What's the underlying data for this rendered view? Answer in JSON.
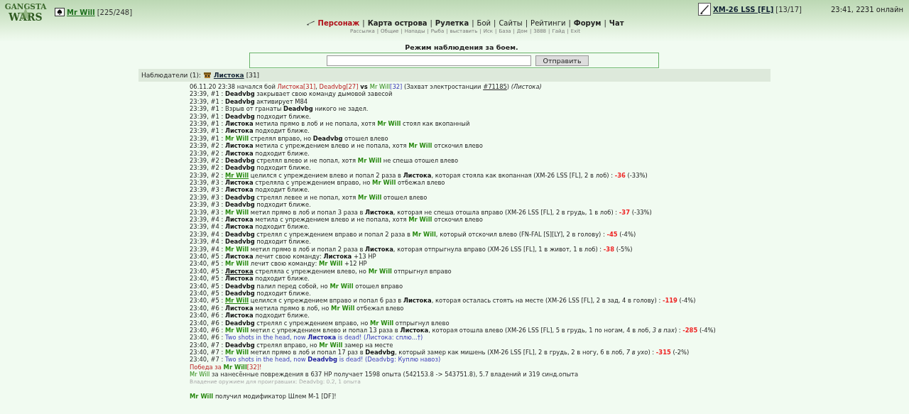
{
  "header": {
    "logo_top": "GANGSTA",
    "logo_bottom": "WARS",
    "player": {
      "name": "Mr Will",
      "hp": "[225/248]"
    },
    "weapon": {
      "name": "XM-26 LSS [FL]",
      "ammo": "[13/17]"
    },
    "status": "23:41, 2231 онлайн"
  },
  "separator": "|",
  "nav": [
    {
      "label": "Персонаж",
      "kind": "current"
    },
    {
      "label": "Карта острова",
      "kind": "bold"
    },
    {
      "label": "Рулетка",
      "kind": "bold"
    },
    {
      "label": "Бой",
      "kind": "plain"
    },
    {
      "label": "Сайты",
      "kind": "plain"
    },
    {
      "label": "Рейтинги",
      "kind": "plain"
    },
    {
      "label": "Форум",
      "kind": "bold"
    },
    {
      "label": "Чат",
      "kind": "bold"
    }
  ],
  "subnav": [
    "Рассылка",
    "Общие",
    "Напады",
    "Рыба",
    "выставить",
    "Иск",
    "База",
    "Дом",
    "3888",
    "Гайд",
    "Exit"
  ],
  "watch": {
    "title": "Режим наблюдения за боем.",
    "button": "Отправить"
  },
  "observers": {
    "label": "Наблюдатели (1):",
    "name": "Листока",
    "level": "[31]"
  },
  "log": [
    {
      "kind": "intro",
      "parts": [
        {
          "kind": "t",
          "text": "06.11.20 23:38 начался бой "
        },
        {
          "kind": "r",
          "text": "Листока[31]"
        },
        {
          "kind": "t",
          "text": ", "
        },
        {
          "kind": "r",
          "text": "Deadvbg[27]"
        },
        {
          "kind": "b",
          "text": " vs "
        },
        {
          "kind": "gn",
          "text": "Mr Will"
        },
        {
          "kind": "blue",
          "text": "[32]"
        },
        {
          "kind": "t",
          "text": " (Захват электростанции "
        },
        {
          "kind": "u",
          "text": "#71185"
        },
        {
          "kind": "t",
          "text": ") "
        },
        {
          "kind": "i",
          "text": "(Листока)"
        }
      ]
    },
    {
      "kind": "log",
      "parts": [
        {
          "kind": "t",
          "text": "23:39, #1 : "
        },
        {
          "kind": "b",
          "text": "Deadvbg"
        },
        {
          "kind": "t",
          "text": " закрывает свою команду дымовой завесой"
        }
      ]
    },
    {
      "kind": "log",
      "parts": [
        {
          "kind": "t",
          "text": "23:39, #1 : "
        },
        {
          "kind": "b",
          "text": "Deadvbg"
        },
        {
          "kind": "t",
          "text": " активирует M84"
        }
      ]
    },
    {
      "kind": "log",
      "parts": [
        {
          "kind": "t",
          "text": "23:39, #1 : Взрыв от гранаты "
        },
        {
          "kind": "b",
          "text": "Deadvbg"
        },
        {
          "kind": "t",
          "text": " никого не задел."
        }
      ]
    },
    {
      "kind": "log",
      "parts": [
        {
          "kind": "t",
          "text": "23:39, #1 : "
        },
        {
          "kind": "b",
          "text": "Deadvbg"
        },
        {
          "kind": "t",
          "text": " подходит ближе."
        }
      ]
    },
    {
      "kind": "log",
      "parts": [
        {
          "kind": "t",
          "text": "23:39, #1 : "
        },
        {
          "kind": "b",
          "text": "Листока"
        },
        {
          "kind": "t",
          "text": " метила прямо в лоб и не попала, хотя "
        },
        {
          "kind": "g",
          "text": "Mr Will"
        },
        {
          "kind": "t",
          "text": " стоял как вкопанный"
        }
      ]
    },
    {
      "kind": "log",
      "parts": [
        {
          "kind": "t",
          "text": "23:39, #1 : "
        },
        {
          "kind": "b",
          "text": "Листока"
        },
        {
          "kind": "t",
          "text": " подходит ближе."
        }
      ]
    },
    {
      "kind": "log",
      "parts": [
        {
          "kind": "t",
          "text": "23:39, #1 : "
        },
        {
          "kind": "g",
          "text": "Mr Will"
        },
        {
          "kind": "t",
          "text": " стрелял вправо, но "
        },
        {
          "kind": "b",
          "text": "Deadvbg"
        },
        {
          "kind": "t",
          "text": " отошел влево"
        }
      ]
    },
    {
      "kind": "log",
      "parts": [
        {
          "kind": "t",
          "text": "23:39, #2 : "
        },
        {
          "kind": "b",
          "text": "Листока"
        },
        {
          "kind": "t",
          "text": " метила с упреждением влево и не попала, хотя "
        },
        {
          "kind": "g",
          "text": "Mr Will"
        },
        {
          "kind": "t",
          "text": " отскочил влево"
        }
      ]
    },
    {
      "kind": "log",
      "parts": [
        {
          "kind": "t",
          "text": "23:39, #2 : "
        },
        {
          "kind": "b",
          "text": "Листока"
        },
        {
          "kind": "t",
          "text": " подходит ближе."
        }
      ]
    },
    {
      "kind": "log",
      "parts": [
        {
          "kind": "t",
          "text": "23:39, #2 : "
        },
        {
          "kind": "b",
          "text": "Deadvbg"
        },
        {
          "kind": "t",
          "text": " стрелял влево и не попал, хотя "
        },
        {
          "kind": "g",
          "text": "Mr Will"
        },
        {
          "kind": "t",
          "text": " не спеша отошел влево"
        }
      ]
    },
    {
      "kind": "log",
      "parts": [
        {
          "kind": "t",
          "text": "23:39, #2 : "
        },
        {
          "kind": "b",
          "text": "Deadvbg"
        },
        {
          "kind": "t",
          "text": " подходит ближе."
        }
      ]
    },
    {
      "kind": "log",
      "parts": [
        {
          "kind": "t",
          "text": "23:39, #2 : "
        },
        {
          "kind": "gu",
          "text": "Mr Will"
        },
        {
          "kind": "t",
          "text": " целился с упреждением влево и попал 2 раза в "
        },
        {
          "kind": "b",
          "text": "Листока"
        },
        {
          "kind": "t",
          "text": ", которая стояла как вкопанная (XM-26 LSS [FL], 2 в лоб) : "
        },
        {
          "kind": "rb",
          "text": "-36"
        },
        {
          "kind": "t",
          "text": " (-33%)"
        }
      ]
    },
    {
      "kind": "log",
      "parts": [
        {
          "kind": "t",
          "text": "23:39, #3 : "
        },
        {
          "kind": "b",
          "text": "Листока"
        },
        {
          "kind": "t",
          "text": " стреляла с упреждением вправо, но "
        },
        {
          "kind": "g",
          "text": "Mr Will"
        },
        {
          "kind": "t",
          "text": " отбежал влево"
        }
      ]
    },
    {
      "kind": "log",
      "parts": [
        {
          "kind": "t",
          "text": "23:39, #3 : "
        },
        {
          "kind": "b",
          "text": "Листока"
        },
        {
          "kind": "t",
          "text": " подходит ближе."
        }
      ]
    },
    {
      "kind": "log",
      "parts": [
        {
          "kind": "t",
          "text": "23:39, #3 : "
        },
        {
          "kind": "b",
          "text": "Deadvbg"
        },
        {
          "kind": "t",
          "text": " стрелял левее и не попал, хотя "
        },
        {
          "kind": "g",
          "text": "Mr Will"
        },
        {
          "kind": "t",
          "text": " отошел влево"
        }
      ]
    },
    {
      "kind": "log",
      "parts": [
        {
          "kind": "t",
          "text": "23:39, #3 : "
        },
        {
          "kind": "b",
          "text": "Deadvbg"
        },
        {
          "kind": "t",
          "text": " подходит ближе."
        }
      ]
    },
    {
      "kind": "log",
      "parts": [
        {
          "kind": "t",
          "text": "23:39, #3 : "
        },
        {
          "kind": "g",
          "text": "Mr Will"
        },
        {
          "kind": "t",
          "text": " метил прямо в лоб и попал 3 раза в "
        },
        {
          "kind": "b",
          "text": "Листока"
        },
        {
          "kind": "t",
          "text": ", которая не спеша отошла вправо (XM-26 LSS [FL], 2 в грудь, 1 в лоб) : "
        },
        {
          "kind": "rb",
          "text": "-37"
        },
        {
          "kind": "t",
          "text": " (-33%)"
        }
      ]
    },
    {
      "kind": "log",
      "parts": [
        {
          "kind": "t",
          "text": "23:39, #4 : "
        },
        {
          "kind": "b",
          "text": "Листока"
        },
        {
          "kind": "t",
          "text": " метила с упреждением влево и не попала, хотя "
        },
        {
          "kind": "g",
          "text": "Mr Will"
        },
        {
          "kind": "t",
          "text": " отскочил влево"
        }
      ]
    },
    {
      "kind": "log",
      "parts": [
        {
          "kind": "t",
          "text": "23:39, #4 : "
        },
        {
          "kind": "b",
          "text": "Листока"
        },
        {
          "kind": "t",
          "text": " подходит ближе."
        }
      ]
    },
    {
      "kind": "log",
      "parts": [
        {
          "kind": "t",
          "text": "23:39, #4 : "
        },
        {
          "kind": "b",
          "text": "Deadvbg"
        },
        {
          "kind": "t",
          "text": " стрелял с упреждением вправо и попал 2 раза в "
        },
        {
          "kind": "g",
          "text": "Mr Will"
        },
        {
          "kind": "t",
          "text": ", который отскочил влево (FN-FAL [S][LY], 2 в голову) : "
        },
        {
          "kind": "rb",
          "text": "-45"
        },
        {
          "kind": "t",
          "text": " (-4%)"
        }
      ]
    },
    {
      "kind": "log",
      "parts": [
        {
          "kind": "t",
          "text": "23:39, #4 : "
        },
        {
          "kind": "b",
          "text": "Deadvbg"
        },
        {
          "kind": "t",
          "text": " подходит ближе."
        }
      ]
    },
    {
      "kind": "log",
      "parts": [
        {
          "kind": "t",
          "text": "23:39, #4 : "
        },
        {
          "kind": "g",
          "text": "Mr Will"
        },
        {
          "kind": "t",
          "text": " метил прямо в лоб и попал 2 раза в "
        },
        {
          "kind": "b",
          "text": "Листока"
        },
        {
          "kind": "t",
          "text": ", которая отпрыгнула вправо (XM-26 LSS [FL], 1 в живот, 1 в лоб) : "
        },
        {
          "kind": "rb",
          "text": "-38"
        },
        {
          "kind": "t",
          "text": " (-5%)"
        }
      ]
    },
    {
      "kind": "log",
      "parts": [
        {
          "kind": "t",
          "text": "23:40, #5 : "
        },
        {
          "kind": "b",
          "text": "Листока"
        },
        {
          "kind": "t",
          "text": " лечит свою команду: "
        },
        {
          "kind": "b",
          "text": "Листока"
        },
        {
          "kind": "t",
          "text": " +13 HP"
        }
      ]
    },
    {
      "kind": "log",
      "parts": [
        {
          "kind": "t",
          "text": "23:40, #5 : "
        },
        {
          "kind": "g",
          "text": "Mr Will"
        },
        {
          "kind": "t",
          "text": " лечит свою команду: "
        },
        {
          "kind": "g",
          "text": "Mr Will"
        },
        {
          "kind": "t",
          "text": " +12 HP"
        }
      ]
    },
    {
      "kind": "log",
      "parts": [
        {
          "kind": "t",
          "text": "23:40, #5 : "
        },
        {
          "kind": "bu",
          "text": "Листока"
        },
        {
          "kind": "t",
          "text": " стреляла с упреждением влево, но "
        },
        {
          "kind": "g",
          "text": "Mr Will"
        },
        {
          "kind": "t",
          "text": " отпрыгнул вправо"
        }
      ]
    },
    {
      "kind": "log",
      "parts": [
        {
          "kind": "t",
          "text": "23:40, #5 : "
        },
        {
          "kind": "b",
          "text": "Листока"
        },
        {
          "kind": "t",
          "text": " подходит ближе."
        }
      ]
    },
    {
      "kind": "log",
      "parts": [
        {
          "kind": "t",
          "text": "23:40, #5 : "
        },
        {
          "kind": "b",
          "text": "Deadvbg"
        },
        {
          "kind": "t",
          "text": " палил перед собой, но "
        },
        {
          "kind": "g",
          "text": "Mr Will"
        },
        {
          "kind": "t",
          "text": " отошел вправо"
        }
      ]
    },
    {
      "kind": "log",
      "parts": [
        {
          "kind": "t",
          "text": "23:40, #5 : "
        },
        {
          "kind": "b",
          "text": "Deadvbg"
        },
        {
          "kind": "t",
          "text": " подходит ближе."
        }
      ]
    },
    {
      "kind": "log",
      "parts": [
        {
          "kind": "t",
          "text": "23:40, #5 : "
        },
        {
          "kind": "gu",
          "text": "Mr Will"
        },
        {
          "kind": "t",
          "text": " целился с упреждением вправо и попал 6 раз в "
        },
        {
          "kind": "b",
          "text": "Листока"
        },
        {
          "kind": "t",
          "text": ", которая осталась стоять на месте (XM-26 LSS [FL], 2 в зад, 4 в голову) : "
        },
        {
          "kind": "rb",
          "text": "-119"
        },
        {
          "kind": "t",
          "text": " (-4%)"
        }
      ]
    },
    {
      "kind": "log",
      "parts": [
        {
          "kind": "t",
          "text": "23:40, #6 : "
        },
        {
          "kind": "b",
          "text": "Листока"
        },
        {
          "kind": "t",
          "text": " метила прямо в лоб, но "
        },
        {
          "kind": "g",
          "text": "Mr Will"
        },
        {
          "kind": "t",
          "text": " отбежал влево"
        }
      ]
    },
    {
      "kind": "log",
      "parts": [
        {
          "kind": "t",
          "text": "23:40, #6 : "
        },
        {
          "kind": "b",
          "text": "Листока"
        },
        {
          "kind": "t",
          "text": " подходит ближе."
        }
      ]
    },
    {
      "kind": "log",
      "parts": [
        {
          "kind": "t",
          "text": "23:40, #6 : "
        },
        {
          "kind": "b",
          "text": "Deadvbg"
        },
        {
          "kind": "t",
          "text": " стрелял с упреждением вправо, но "
        },
        {
          "kind": "g",
          "text": "Mr Will"
        },
        {
          "kind": "t",
          "text": " отпрыгнул влево"
        }
      ]
    },
    {
      "kind": "log",
      "parts": [
        {
          "kind": "t",
          "text": "23:40, #6 : "
        },
        {
          "kind": "g",
          "text": "Mr Will"
        },
        {
          "kind": "t",
          "text": " метил с упреждением влево и попал 13 раза в "
        },
        {
          "kind": "b",
          "text": "Листока"
        },
        {
          "kind": "t",
          "text": ", которая отошла влево (XM-26 LSS [FL], 5 в грудь, 1 по ногам, 4 в лоб, "
        },
        {
          "kind": "i",
          "text": "3 в пах"
        },
        {
          "kind": "t",
          "text": ") : "
        },
        {
          "kind": "rb",
          "text": "-285"
        },
        {
          "kind": "t",
          "text": " (-4%)"
        }
      ]
    },
    {
      "kind": "dead",
      "parts": [
        {
          "kind": "t",
          "text": "23:40, #6 : "
        },
        {
          "kind": "blue",
          "text": "Two shots in the head, now "
        },
        {
          "kind": "bb",
          "text": "Листока"
        },
        {
          "kind": "blue",
          "text": " is dead! (Листока: сплю...†)"
        }
      ]
    },
    {
      "kind": "log",
      "parts": [
        {
          "kind": "t",
          "text": "23:40, #7 : "
        },
        {
          "kind": "b",
          "text": "Deadvbg"
        },
        {
          "kind": "t",
          "text": " стрелял вправо, но "
        },
        {
          "kind": "g",
          "text": "Mr Will"
        },
        {
          "kind": "t",
          "text": " замер на месте"
        }
      ]
    },
    {
      "kind": "log",
      "parts": [
        {
          "kind": "t",
          "text": "23:40, #7 : "
        },
        {
          "kind": "g",
          "text": "Mr Will"
        },
        {
          "kind": "t",
          "text": " метил прямо в лоб и попал 17 раз в "
        },
        {
          "kind": "b",
          "text": "Deadvbg"
        },
        {
          "kind": "t",
          "text": ", который замер как мишень (XM-26 LSS [FL], 2 в грудь, 2 в ногу, 6 в лоб, "
        },
        {
          "kind": "i",
          "text": "7 в ухо"
        },
        {
          "kind": "t",
          "text": ") : "
        },
        {
          "kind": "rb",
          "text": "-315"
        },
        {
          "kind": "t",
          "text": " (-2%)"
        }
      ]
    },
    {
      "kind": "dead",
      "parts": [
        {
          "kind": "t",
          "text": "23:40, #7 : "
        },
        {
          "kind": "blue",
          "text": "Two shots in the head, now "
        },
        {
          "kind": "bb",
          "text": "Deadvbg"
        },
        {
          "kind": "blue",
          "text": " is dead! (Deadvbg: Куплю навоз)"
        }
      ]
    },
    {
      "kind": "win",
      "parts": [
        {
          "kind": "r",
          "text": "Победа за "
        },
        {
          "kind": "g",
          "text": "Mr Will"
        },
        {
          "kind": "r",
          "text": "[32]!"
        }
      ]
    },
    {
      "kind": "exp",
      "parts": [
        {
          "kind": "gn",
          "text": "Mr Will"
        },
        {
          "kind": "t",
          "text": " за нанесённые повреждения в 637 HP получает 1598 опыта (542153.8 -> 543751.8), 5.7 владений и 319 синд.опыта"
        }
      ]
    },
    {
      "kind": "note",
      "parts": [
        {
          "kind": "t",
          "text": "Владение оружием для проигравших: Deadvbg: 0.2, 1 опыта"
        }
      ]
    },
    {
      "kind": "mod",
      "parts": [
        {
          "kind": "g",
          "text": "Mr Will"
        },
        {
          "kind": "t",
          "text": " получил модификатор Шлем М-1 [DF]!"
        }
      ]
    }
  ]
}
